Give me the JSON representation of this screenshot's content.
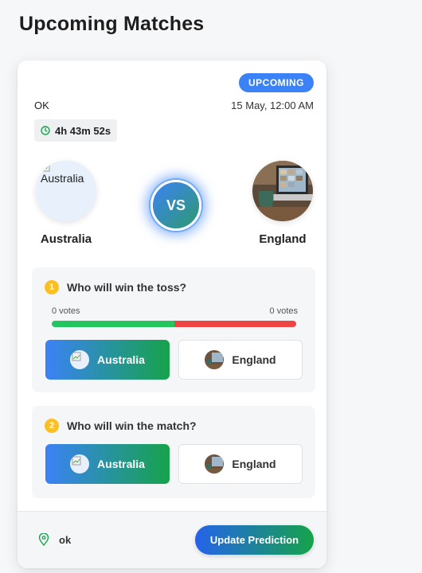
{
  "page": {
    "title": "Upcoming Matches"
  },
  "match": {
    "status": "UPCOMING",
    "title": "OK",
    "date": "15 May, 12:00 AM",
    "countdown": "4h 43m 52s",
    "vs_label": "VS",
    "team_a": {
      "name": "Australia",
      "image_alt": "Australia"
    },
    "team_b": {
      "name": "England"
    }
  },
  "questions": [
    {
      "number": "1",
      "text": "Who will win the toss?",
      "votes_a": "0 votes",
      "votes_b": "0 votes",
      "split_a": 0.5,
      "options": [
        "Australia",
        "England"
      ],
      "selected": "Australia"
    },
    {
      "number": "2",
      "text": "Who will win the match?",
      "options": [
        "Australia",
        "England"
      ],
      "selected": "Australia"
    }
  ],
  "footer": {
    "location": "ok",
    "button_label": "Update Prediction",
    "location_icon": "map-pin-icon"
  },
  "colors": {
    "accent_blue": "#3b82f6",
    "accent_green": "#16a34a",
    "vote_green": "#22c55e",
    "vote_red": "#ef4444",
    "number_yellow": "#fbbf24"
  }
}
